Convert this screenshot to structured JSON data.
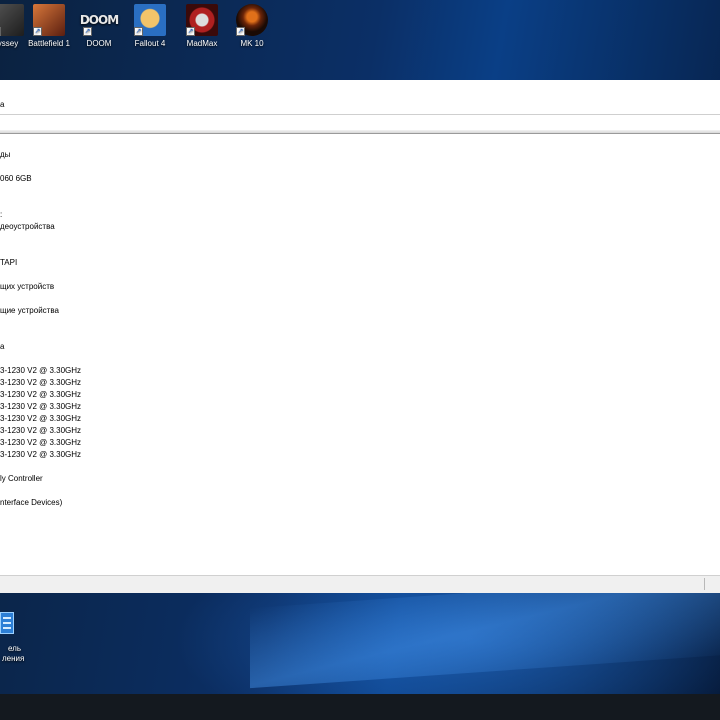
{
  "desktop": {
    "icons": [
      {
        "label": "yssey",
        "icon": "game-odyssey-icon",
        "color": "#3a3a3a",
        "glyph": ""
      },
      {
        "label": "Battlefield 1",
        "icon": "game-battlefield-icon",
        "color": "#b5532a",
        "glyph": ""
      },
      {
        "label": "DOOM",
        "icon": "game-doom-icon",
        "color": "#1c1c1c",
        "glyph": "DOOM"
      },
      {
        "label": "Fallout 4",
        "icon": "game-fallout-icon",
        "color": "#2a6fc2",
        "glyph": ""
      },
      {
        "label": "MadMax",
        "icon": "game-madmax-icon",
        "color": "#8a1f1f",
        "glyph": ""
      },
      {
        "label": "MK 10",
        "icon": "game-mk10-icon",
        "color": "#5a2a10",
        "glyph": ""
      }
    ],
    "bottom_icon": {
      "label_line1": "ель",
      "label_line2": "ления",
      "icon": "control-panel-icon"
    }
  },
  "window": {
    "toolbar_label": "а",
    "tree": [
      "ды",
      "060 6GB",
      ":",
      "деоустройства",
      "TAPI",
      "щих устройств",
      "щие устройства",
      "а",
      "3-1230 V2 @ 3.30GHz",
      "3-1230 V2 @ 3.30GHz",
      "3-1230 V2 @ 3.30GHz",
      "3-1230 V2 @ 3.30GHz",
      "3-1230 V2 @ 3.30GHz",
      "3-1230 V2 @ 3.30GHz",
      "3-1230 V2 @ 3.30GHz",
      "3-1230 V2 @ 3.30GHz",
      "ly Controller",
      "nterface Devices)"
    ]
  },
  "colors": {
    "window_bg": "#ffffff",
    "taskbar": "#14191f",
    "accent": "#2d7fd6"
  }
}
